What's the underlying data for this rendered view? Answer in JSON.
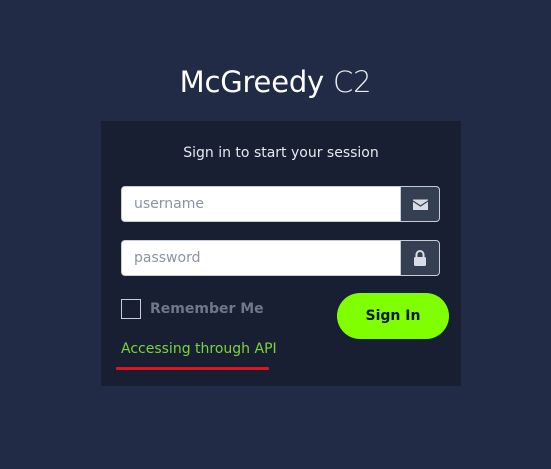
{
  "logo": {
    "brand": "McGreedy",
    "suffix": "C2"
  },
  "card": {
    "message": "Sign in to start your session"
  },
  "username": {
    "placeholder": "username",
    "icon": "envelope-icon"
  },
  "password": {
    "placeholder": "password",
    "icon": "lock-icon"
  },
  "remember": {
    "label": "Remember Me",
    "checked": false
  },
  "signin": {
    "label": "Sign In"
  },
  "api_link": {
    "text": "Accessing through API"
  },
  "colors": {
    "background": "#212b45",
    "card": "#181f32",
    "accent": "#80ff00",
    "link": "#7ad43c",
    "annotation": "#e0141b",
    "addon": "#353f52"
  }
}
